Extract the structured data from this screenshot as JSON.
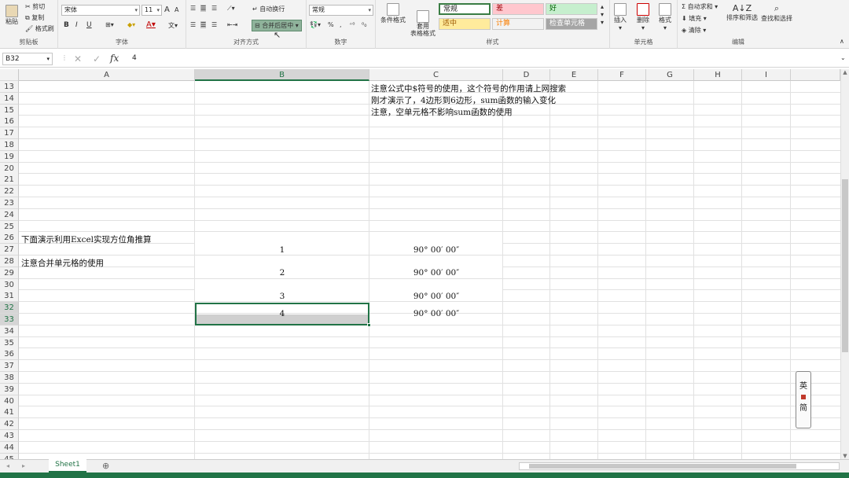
{
  "ribbon": {
    "clipboard": {
      "paste": "粘贴",
      "cut": "剪切",
      "copy": "复制",
      "format_painter": "格式刷",
      "group": "剪贴板"
    },
    "font": {
      "name": "宋体",
      "size": "11",
      "group": "字体",
      "grow": "A",
      "shrink": "A",
      "bold": "B",
      "italic": "I",
      "underline": "U",
      "font_color_letter": "A",
      "wen": "文"
    },
    "alignment": {
      "wrap": "自动换行",
      "merge": "合并后居中",
      "group": "对齐方式"
    },
    "number": {
      "format": "常规",
      "percent": "%",
      "comma": ",",
      "group": "数字"
    },
    "styles": {
      "conditional": "条件格式",
      "table": "套用\n表格格式",
      "group": "样式",
      "cells": [
        {
          "label": "常规",
          "bg": "#ffffff"
        },
        {
          "label": "差",
          "bg": "#ffc7ce",
          "color": "#9c0006"
        },
        {
          "label": "好",
          "bg": "#c6efce",
          "color": "#006100"
        },
        {
          "label": "适中",
          "bg": "#ffeb9c",
          "color": "#9c5700"
        },
        {
          "label": "计算",
          "bg": "#f2f2f2",
          "color": "#fa7d00"
        },
        {
          "label": "检查单元格",
          "bg": "#a5a5a5",
          "color": "#ffffff"
        }
      ]
    },
    "cells_group": {
      "insert": "插入",
      "delete": "删除",
      "format": "格式",
      "group": "单元格"
    },
    "editing": {
      "autosum": "自动求和",
      "fill": "填充",
      "clear": "清除",
      "sort": "排序和筛选",
      "find": "查找和选择",
      "group": "编辑"
    }
  },
  "formula_bar": {
    "name_box": "B32",
    "fx": "fx",
    "content": "4"
  },
  "columns": [
    "A",
    "B",
    "C",
    "D",
    "E",
    "F",
    "G",
    "H",
    "I"
  ],
  "rows": [
    "13",
    "14",
    "15",
    "16",
    "17",
    "18",
    "19",
    "20",
    "21",
    "22",
    "23",
    "24",
    "25",
    "26",
    "27",
    "28",
    "29",
    "30",
    "31",
    "32",
    "33",
    "34",
    "35",
    "36",
    "37",
    "38",
    "39",
    "40",
    "41",
    "42",
    "43",
    "44",
    "45"
  ],
  "cells": {
    "c13": "注意公式中$符号的使用，这个符号的作用请上网搜索",
    "c14": "刚才演示了，4边形到6边形，sum函数的输入变化",
    "c15": "注意，空单元格不影响sum函数的使用",
    "a26": "下面演示利用Excel实现方位角推算",
    "a28": "注意合并单元格的使用",
    "b_vals": [
      "1",
      "2",
      "3",
      "4"
    ],
    "c_vals": [
      "90° 00′ 00″",
      "90° 00′ 00″",
      "90° 00′ 00″",
      "90° 00′ 00″"
    ]
  },
  "sheet_tab": "Sheet1",
  "watermark": [
    "英",
    "简"
  ]
}
